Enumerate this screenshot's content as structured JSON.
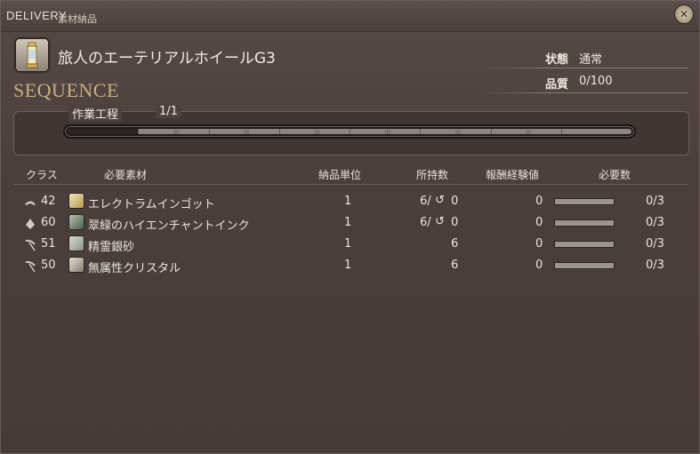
{
  "window": {
    "title": "DELIVERY",
    "subtitle": "素材納品",
    "close_icon": "close-gear-icon"
  },
  "item": {
    "name": "旅人のエーテリアルホイールG3",
    "icon": "aetherial-wheel-icon"
  },
  "status": {
    "condition_label": "状態",
    "condition_value": "通常",
    "quality_label": "品質",
    "quality_value": "0/100"
  },
  "sequence": {
    "title": "SEQUENCE",
    "step_label": "作業工程",
    "step_count": "1/1",
    "progress_fraction": 0.125
  },
  "table": {
    "headers": {
      "class": "クラス",
      "material": "必要素材",
      "unit": "納品単位",
      "owned": "所持数",
      "exp": "報酬経験値",
      "required": "必要数"
    },
    "rows": [
      {
        "class_icon": "armorer-icon",
        "class_level": "42",
        "material_icon": "ingot-icon",
        "name": "エレクトラムインゴット",
        "unit": "1",
        "owned_nq": "6/",
        "owned_hq": "0",
        "has_hq": true,
        "exp": "0",
        "required": "0/3",
        "progress": 0
      },
      {
        "class_icon": "alchemist-icon",
        "class_level": "60",
        "material_icon": "ink-icon",
        "name": "翠緑のハイエンチャントインク",
        "unit": "1",
        "owned_nq": "6/",
        "owned_hq": "0",
        "has_hq": true,
        "exp": "0",
        "required": "0/3",
        "progress": 0
      },
      {
        "class_icon": "miner-icon",
        "class_level": "51",
        "material_icon": "sand-icon",
        "name": "精霊銀砂",
        "unit": "1",
        "owned_nq": "6",
        "owned_hq": "",
        "has_hq": false,
        "exp": "0",
        "required": "0/3",
        "progress": 0
      },
      {
        "class_icon": "miner-icon",
        "class_level": "50",
        "material_icon": "crystal-icon",
        "name": "無属性クリスタル",
        "unit": "1",
        "owned_nq": "6",
        "owned_hq": "",
        "has_hq": false,
        "exp": "0",
        "required": "0/3",
        "progress": 0
      }
    ]
  },
  "colors": {
    "background": "#4a3f3c",
    "accent": "#c9b07a"
  }
}
